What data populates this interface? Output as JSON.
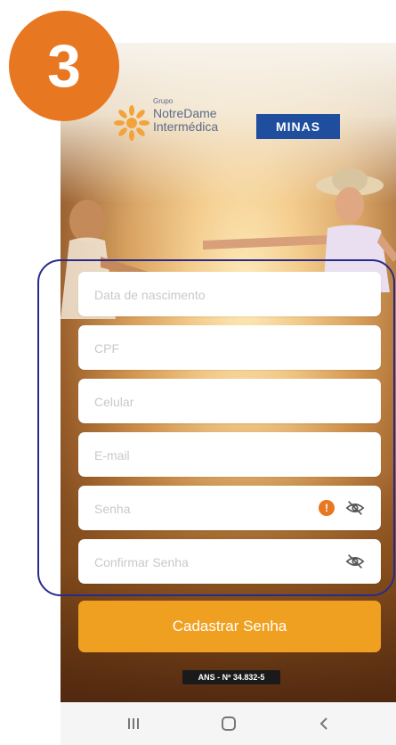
{
  "step": {
    "number": "3"
  },
  "brand": {
    "small": "Grupo",
    "line1": "NotreDame",
    "line2": "Intermédica",
    "region": "MINAS",
    "logo_icon": "sun-flower-logo-icon"
  },
  "form": {
    "fields": [
      {
        "name": "birthdate",
        "placeholder": "Data de nascimento"
      },
      {
        "name": "cpf",
        "placeholder": "CPF"
      },
      {
        "name": "phone",
        "placeholder": "Celular"
      },
      {
        "name": "email",
        "placeholder": "E-mail"
      },
      {
        "name": "password",
        "placeholder": "Senha",
        "warning": "!",
        "icon": "eye-off-icon"
      },
      {
        "name": "confirm_password",
        "placeholder": "Confirmar Senha",
        "icon": "eye-off-icon"
      }
    ],
    "submit_label": "Cadastrar Senha"
  },
  "footer": {
    "ans": "ANS - Nº 34.832-5"
  },
  "nav": {
    "recents_icon": "recent-apps-icon",
    "home_icon": "home-icon",
    "back_icon": "back-icon"
  },
  "colors": {
    "accent_orange": "#e87722",
    "button_orange": "#f0a020",
    "brand_blue": "#1f4e9e",
    "highlight_border": "#2a2a8c"
  }
}
